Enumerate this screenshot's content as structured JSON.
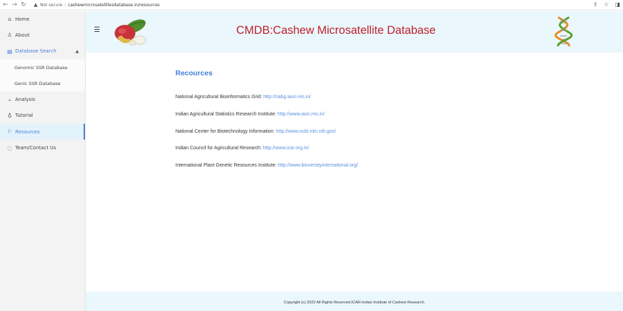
{
  "browser": {
    "back": "←",
    "forward": "→",
    "reload": "↻",
    "security_label": "Not secure",
    "separator": "|",
    "url": "cashewmicrosatellitesdatabase.in/resources"
  },
  "sidebar": {
    "items": [
      {
        "label": "Home",
        "icon": "home-icon"
      },
      {
        "label": "About",
        "icon": "person-icon"
      },
      {
        "label": "Database Search",
        "icon": "database-icon"
      },
      {
        "label": "Genomic SSR Database",
        "icon": ""
      },
      {
        "label": "Genic SSR Database",
        "icon": ""
      },
      {
        "label": "Analysis",
        "icon": "chart-icon"
      },
      {
        "label": "Tutorial",
        "icon": "lightbulb-icon"
      },
      {
        "label": "Resources",
        "icon": "flag-icon"
      },
      {
        "label": "Team/Contact Us",
        "icon": "chat-icon"
      }
    ]
  },
  "header": {
    "title": "CMDB:Cashew Microsatellite Database"
  },
  "main": {
    "title": "Recources",
    "resources": [
      {
        "name": "National Agricultural Bioinformatics Grid: ",
        "link": "http://nabg.iasri.res.in/"
      },
      {
        "name": "Indian Agricultural Statistics Research Institute: ",
        "link": "http://www.iasri.res.in/"
      },
      {
        "name": "National Center for Biotechnology Information: ",
        "link": "http://www.ncbi.nlm.nih.gov/"
      },
      {
        "name": "Indian Council for Agricultural Research: ",
        "link": "http://www.icar.org.in/"
      },
      {
        "name": "International Plant Genetic Resources Institute: ",
        "link": "http://www.bioversityinternational.org/"
      }
    ]
  },
  "footer": {
    "text": "Copyright (c) 2022 All Rights Reserved.ICAR-Indian Institute of Cashew Research."
  },
  "colors": {
    "title_red": "#c0202a",
    "accent_blue": "#3d7fd9",
    "header_bg": "#eaf7fc",
    "sidebar_bg": "#f3f3f3"
  }
}
